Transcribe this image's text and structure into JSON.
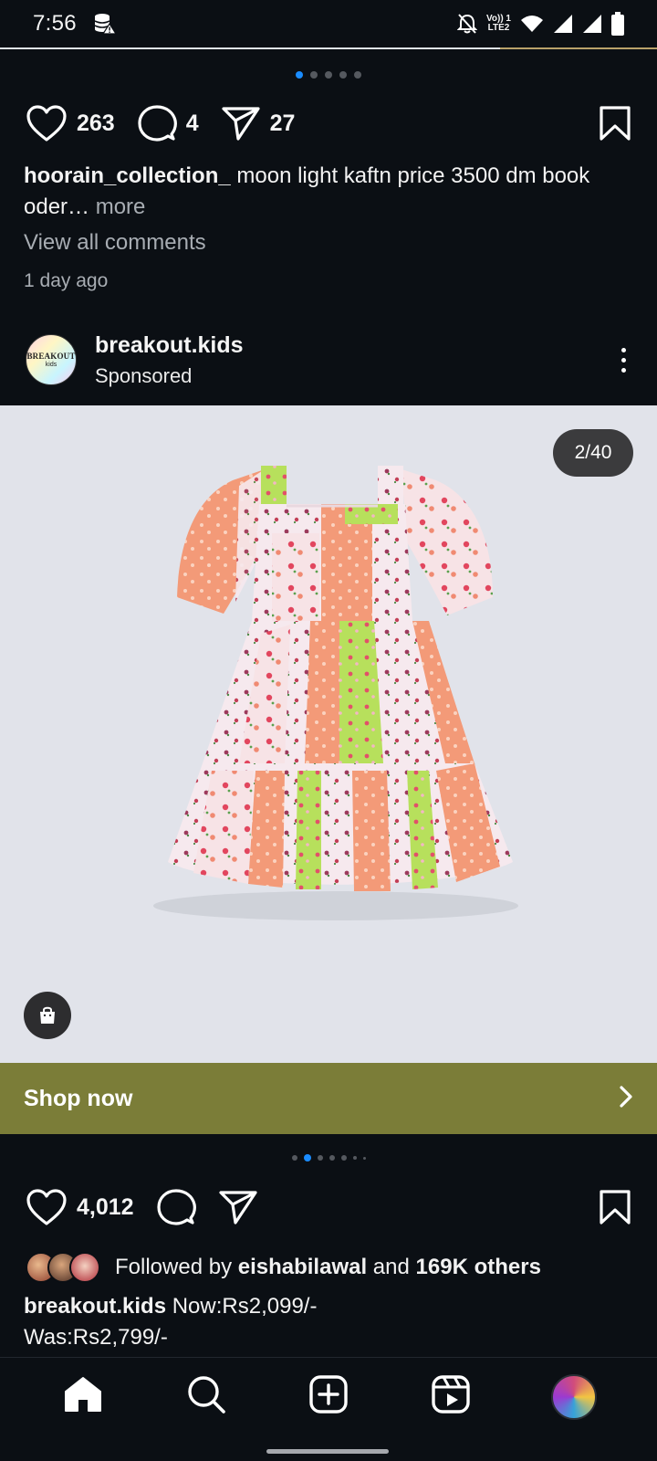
{
  "status_bar": {
    "time": "7:56",
    "network_lines": [
      "Vo)) 1",
      "LTE2"
    ],
    "icons": [
      "storage-warning-icon",
      "bell-off-icon",
      "wifi-icon",
      "signal-icon",
      "signal-icon",
      "battery-icon"
    ]
  },
  "post1": {
    "carousel": {
      "count": 5,
      "active_index": 0
    },
    "likes": "263",
    "comments": "4",
    "shares": "27",
    "username": "hoorain_collection_",
    "caption_text": " moon light kaftn price 3500 dm book oder",
    "caption_ellipsis": "…",
    "more_label": " more",
    "view_comments": "View all comments",
    "time_ago": "1 day ago"
  },
  "post2": {
    "username": "breakout.kids",
    "subtitle": "Sponsored",
    "avatar_logo": {
      "text": "BREAKOUT",
      "subtext": "kids"
    },
    "counter": "2/40",
    "cta_label": "Shop now",
    "carousel": {
      "count": 7,
      "active_index": 1
    },
    "likes": "4,012",
    "followed_prefix": "Followed by ",
    "followed_user": "eishabilawal",
    "followed_and": " and ",
    "followed_others": "169K others",
    "caption_user": "breakout.kids",
    "caption_line1": " Now:Rs2,099/-",
    "caption_line2": "Was:Rs2,799/-"
  },
  "bottom_nav": {
    "items": [
      "home-icon",
      "search-icon",
      "create-icon",
      "reels-icon",
      "profile-avatar"
    ],
    "active": "home-icon"
  },
  "colors": {
    "background": "#0b0f14",
    "accent_blue": "#1a8cff",
    "cta_green": "#7b7d38",
    "media_bg": "#e1e3ea"
  }
}
